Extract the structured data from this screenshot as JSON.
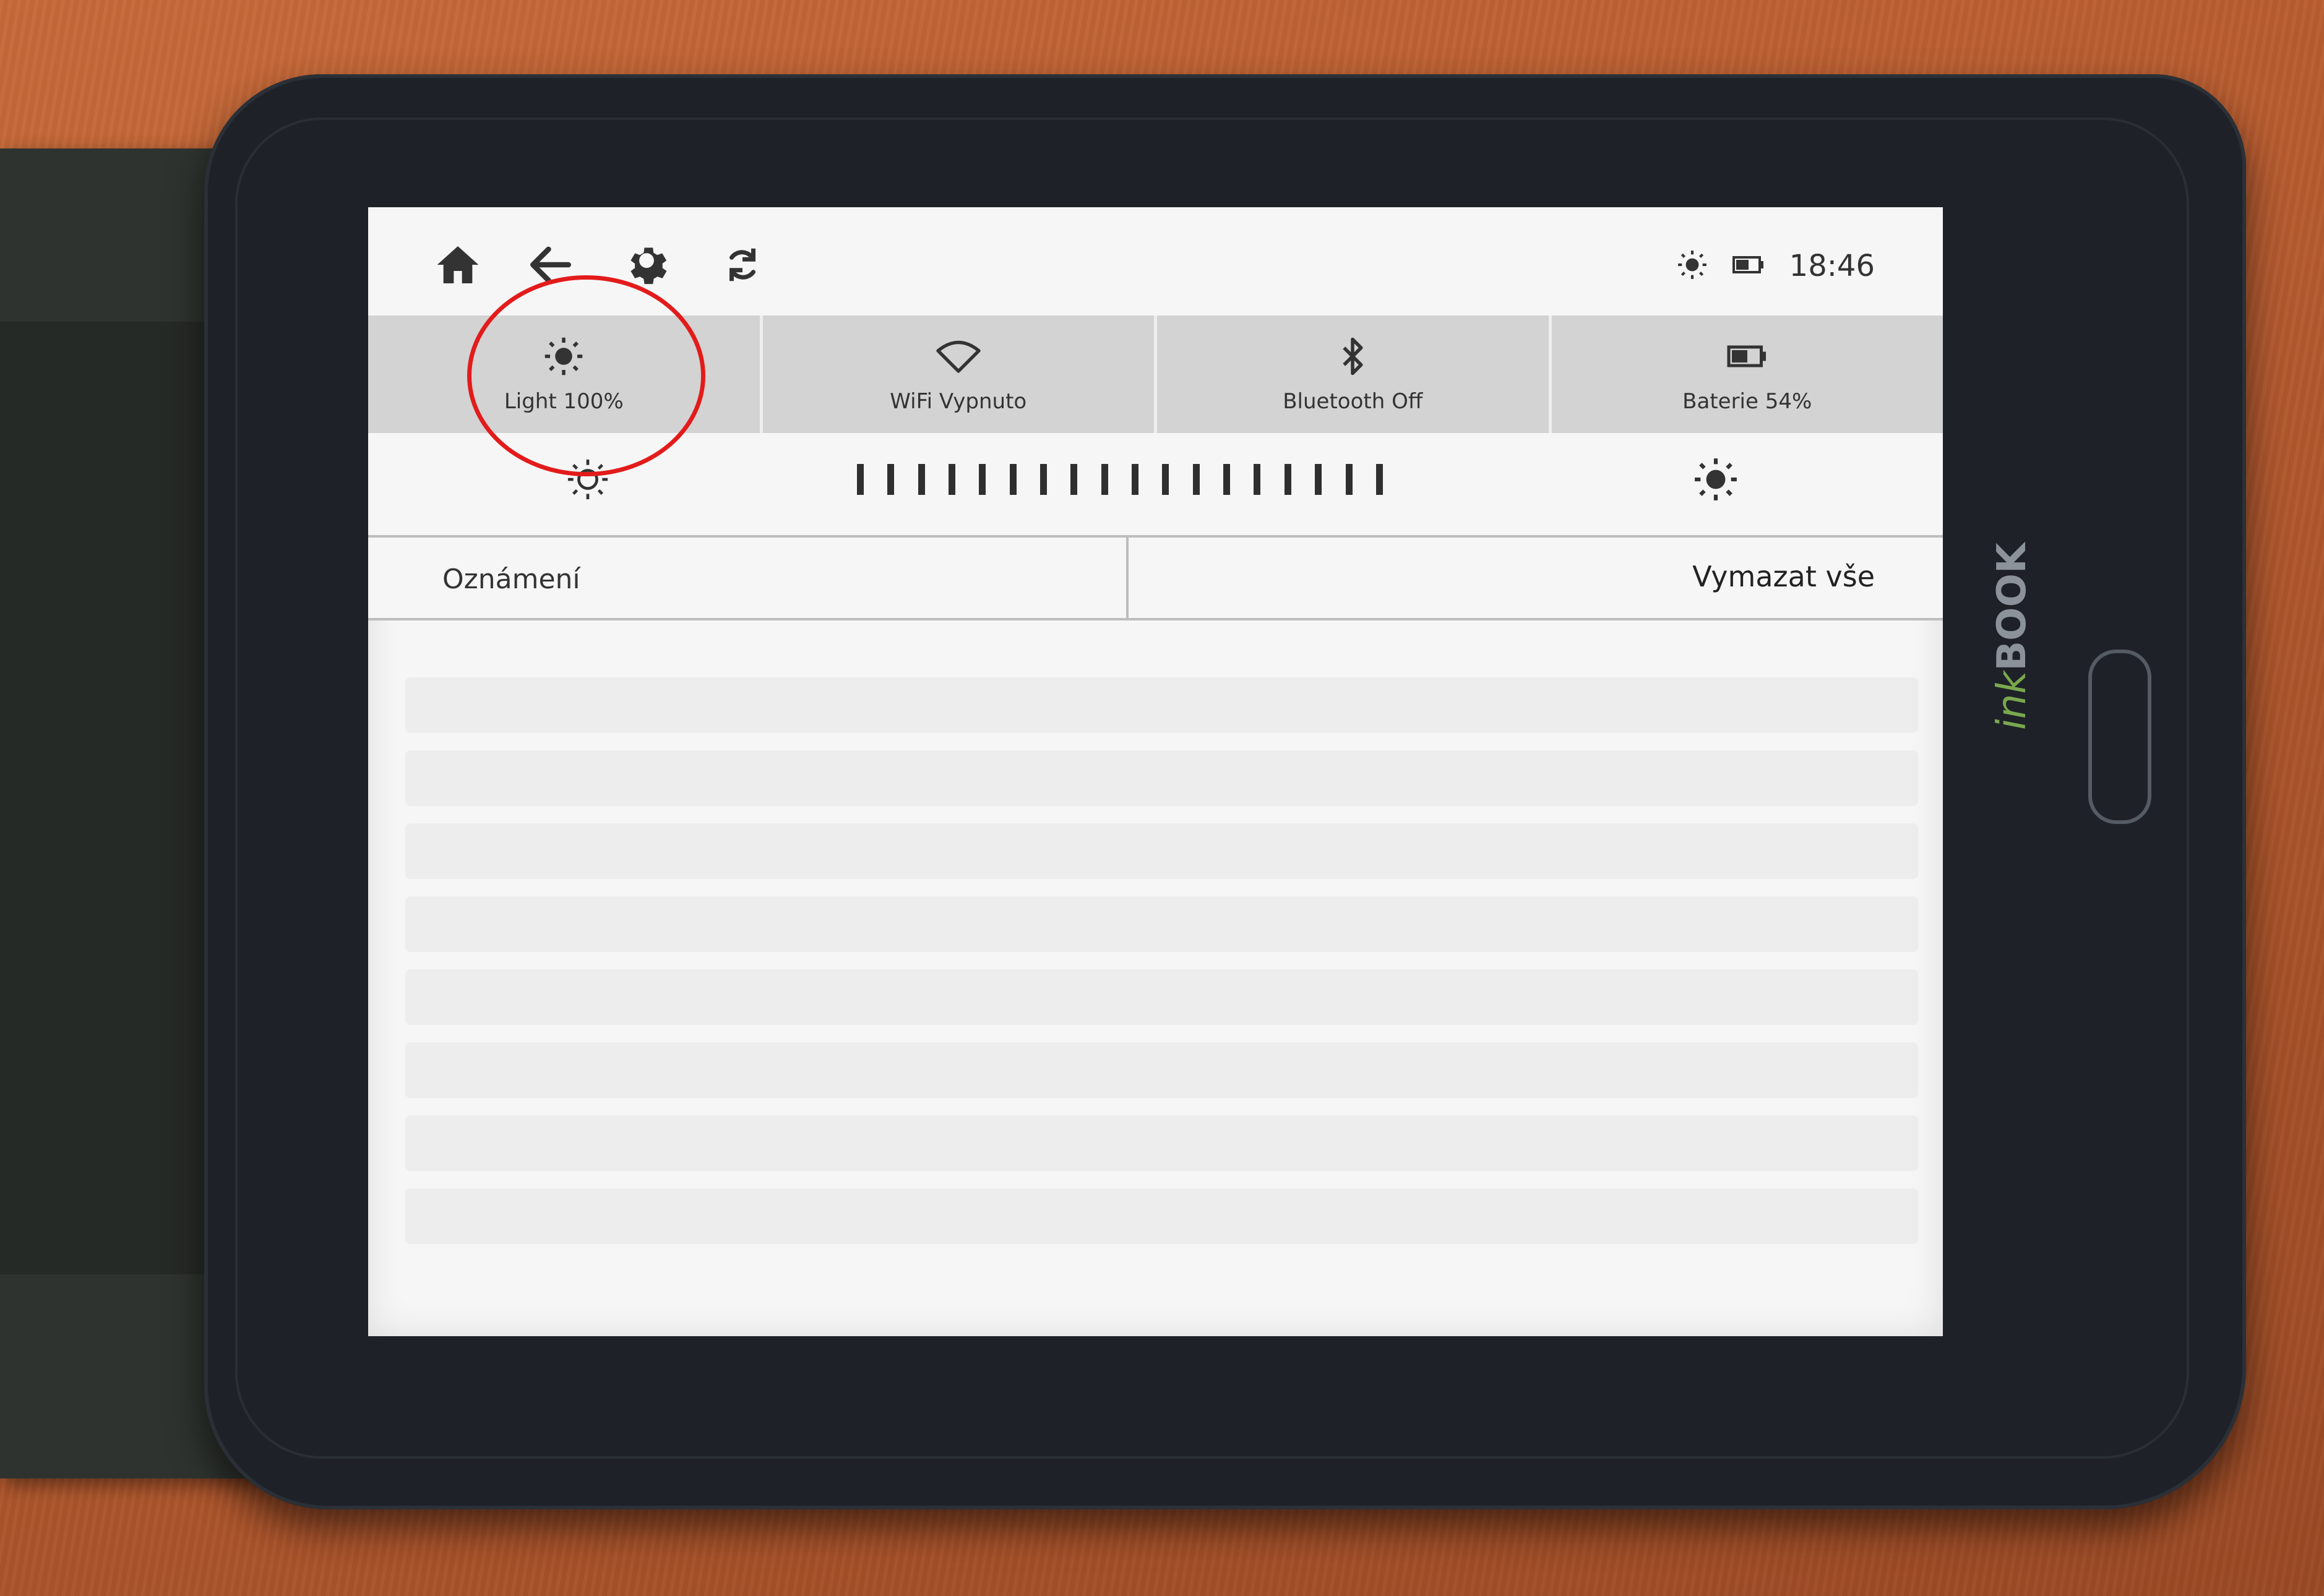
{
  "topbar": {
    "icons": [
      "home-icon",
      "back-arrow-icon",
      "settings-gear-icon",
      "sync-icon"
    ],
    "status": {
      "light_icon": "sun-icon",
      "battery_icon": "battery-icon",
      "time": "18:46"
    }
  },
  "quick_tiles": [
    {
      "id": "light",
      "icon": "sun-icon",
      "label": "Light 100%"
    },
    {
      "id": "wifi",
      "icon": "wifi-icon",
      "label": "WiFi Vypnuto"
    },
    {
      "id": "bluetooth",
      "icon": "bluetooth-icon",
      "label": "Bluetooth Off"
    },
    {
      "id": "battery",
      "icon": "battery-icon",
      "label": "Baterie 54%"
    }
  ],
  "brightness": {
    "level_percent": 100,
    "low_icon": "sun-outline-icon",
    "high_icon": "sun-icon"
  },
  "notifications": {
    "title": "Oznámení",
    "clear_all": "Vymazat vše"
  },
  "device": {
    "brand_prefix": "ink",
    "brand_name": "BOOK"
  },
  "annotation": {
    "highlight_color": "#e31b1b"
  }
}
